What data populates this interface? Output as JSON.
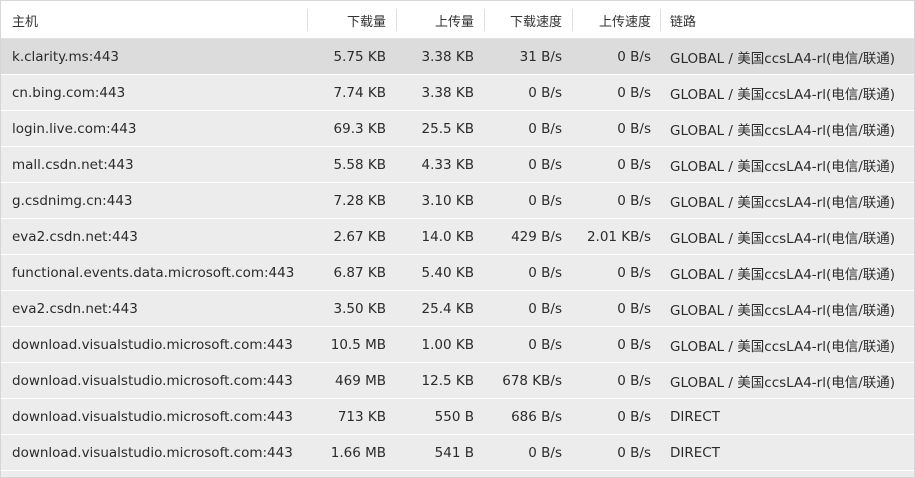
{
  "columns": {
    "host": "主机",
    "download": "下载量",
    "upload": "上传量",
    "download_speed": "下载速度",
    "upload_speed": "上传速度",
    "chain": "链路"
  },
  "rows": [
    {
      "host": "k.clarity.ms:443",
      "download": "5.75 KB",
      "upload": "3.38 KB",
      "download_speed": "31 B/s",
      "upload_speed": "0 B/s",
      "chain": "GLOBAL / 美国ccsLA4-rl(电信/联通)"
    },
    {
      "host": "cn.bing.com:443",
      "download": "7.74 KB",
      "upload": "3.38 KB",
      "download_speed": "0 B/s",
      "upload_speed": "0 B/s",
      "chain": "GLOBAL / 美国ccsLA4-rl(电信/联通)"
    },
    {
      "host": "login.live.com:443",
      "download": "69.3 KB",
      "upload": "25.5 KB",
      "download_speed": "0 B/s",
      "upload_speed": "0 B/s",
      "chain": "GLOBAL / 美国ccsLA4-rl(电信/联通)"
    },
    {
      "host": "mall.csdn.net:443",
      "download": "5.58 KB",
      "upload": "4.33 KB",
      "download_speed": "0 B/s",
      "upload_speed": "0 B/s",
      "chain": "GLOBAL / 美国ccsLA4-rl(电信/联通)"
    },
    {
      "host": "g.csdnimg.cn:443",
      "download": "7.28 KB",
      "upload": "3.10 KB",
      "download_speed": "0 B/s",
      "upload_speed": "0 B/s",
      "chain": "GLOBAL / 美国ccsLA4-rl(电信/联通)"
    },
    {
      "host": "eva2.csdn.net:443",
      "download": "2.67 KB",
      "upload": "14.0 KB",
      "download_speed": "429 B/s",
      "upload_speed": "2.01 KB/s",
      "chain": "GLOBAL / 美国ccsLA4-rl(电信/联通)"
    },
    {
      "host": "functional.events.data.microsoft.com:443",
      "download": "6.87 KB",
      "upload": "5.40 KB",
      "download_speed": "0 B/s",
      "upload_speed": "0 B/s",
      "chain": "GLOBAL / 美国ccsLA4-rl(电信/联通)"
    },
    {
      "host": "eva2.csdn.net:443",
      "download": "3.50 KB",
      "upload": "25.4 KB",
      "download_speed": "0 B/s",
      "upload_speed": "0 B/s",
      "chain": "GLOBAL / 美国ccsLA4-rl(电信/联通)"
    },
    {
      "host": "download.visualstudio.microsoft.com:443",
      "download": "10.5 MB",
      "upload": "1.00 KB",
      "download_speed": "0 B/s",
      "upload_speed": "0 B/s",
      "chain": "GLOBAL / 美国ccsLA4-rl(电信/联通)"
    },
    {
      "host": "download.visualstudio.microsoft.com:443",
      "download": "469 MB",
      "upload": "12.5 KB",
      "download_speed": "678 KB/s",
      "upload_speed": "0 B/s",
      "chain": "GLOBAL / 美国ccsLA4-rl(电信/联通)"
    },
    {
      "host": "download.visualstudio.microsoft.com:443",
      "download": "713 KB",
      "upload": "550 B",
      "download_speed": "686 B/s",
      "upload_speed": "0 B/s",
      "chain": "DIRECT"
    },
    {
      "host": "download.visualstudio.microsoft.com:443",
      "download": "1.66 MB",
      "upload": "541 B",
      "download_speed": "0 B/s",
      "upload_speed": "0 B/s",
      "chain": "DIRECT"
    }
  ],
  "colors": {
    "row_bg": "#ececec",
    "selected_row_bg": "#dcdcdc",
    "header_bg": "#ffffff",
    "text": "#2b2b2b"
  }
}
